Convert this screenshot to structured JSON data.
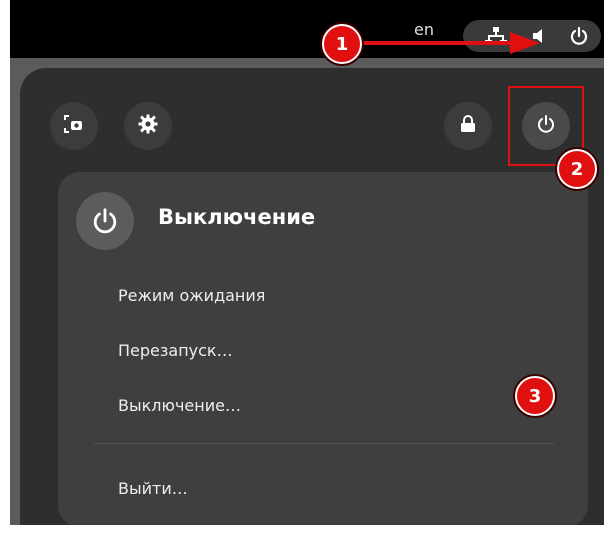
{
  "topbar": {
    "keyboard_layout": "en",
    "icons": [
      "network-icon",
      "volume-icon",
      "power-icon"
    ]
  },
  "quick_settings": {
    "buttons": [
      "screenshot-icon",
      "settings-icon",
      "lock-icon",
      "power-icon"
    ]
  },
  "power_menu": {
    "title": "Выключение",
    "items": [
      {
        "label": "Режим ожидания"
      },
      {
        "label": "Перезапуск…"
      },
      {
        "label": "Выключение…"
      }
    ],
    "logout_label": "Выйти…"
  },
  "annotations": {
    "step1": "1",
    "step2": "2",
    "step3": "3",
    "color": "#e01010"
  }
}
